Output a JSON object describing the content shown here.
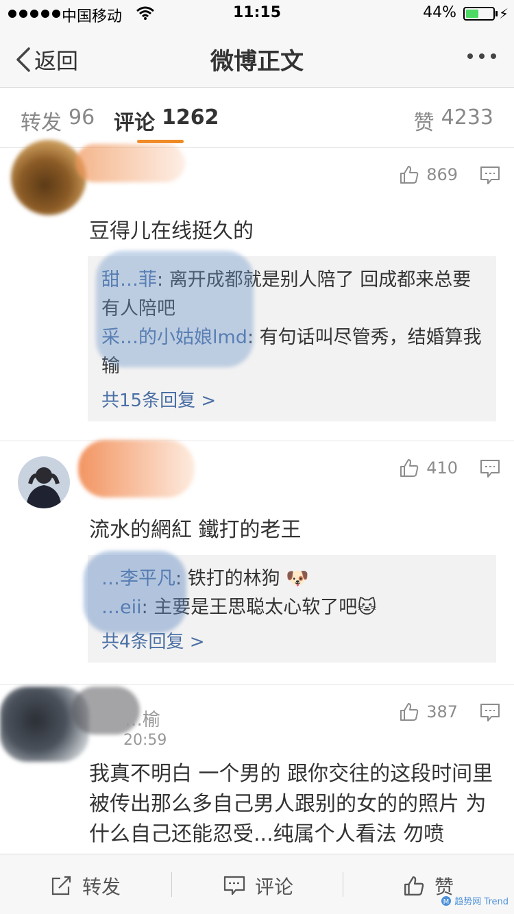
{
  "status_bar": {
    "carrier": "中国移动",
    "time": "11:15",
    "battery": "44%"
  },
  "nav": {
    "back_label": "返回",
    "title": "微博正文"
  },
  "tabs": {
    "repost": {
      "label": "转发",
      "count": "96"
    },
    "comment": {
      "label": "评论",
      "count": "1262"
    },
    "like": {
      "label": "赞",
      "count": "4233"
    }
  },
  "comments": [
    {
      "likes": "869",
      "text": "豆得儿在线挺久的",
      "replies": [
        {
          "user": "甜…菲",
          "text": "离开成都就是别人陪了 回成都来总要有人陪吧"
        },
        {
          "user": "采…的小姑娘lmd",
          "text": "有句话叫尽管秀，结婚算我输"
        }
      ],
      "more": "共15条回复 >"
    },
    {
      "likes": "410",
      "text": "流水的網紅 鐵打的老王",
      "replies": [
        {
          "user": "…李平凡",
          "text": "铁打的林狗"
        },
        {
          "user": "…eii",
          "text": "主要是王思聪太心软了吧"
        }
      ],
      "more": "共4条回复 >"
    },
    {
      "name": "…榆",
      "time": "20:59",
      "likes": "387",
      "text": "我真不明白 一个男的 跟你交往的这段时间里被传出那么多自己男人跟别的女的的照片 为什么自己还能忍受...纯属个人看法 勿喷"
    }
  ],
  "bottom_bar": {
    "repost_label": "转发",
    "comment_label": "评论",
    "like_label": "赞"
  },
  "watermark": "趋势网 Trend"
}
